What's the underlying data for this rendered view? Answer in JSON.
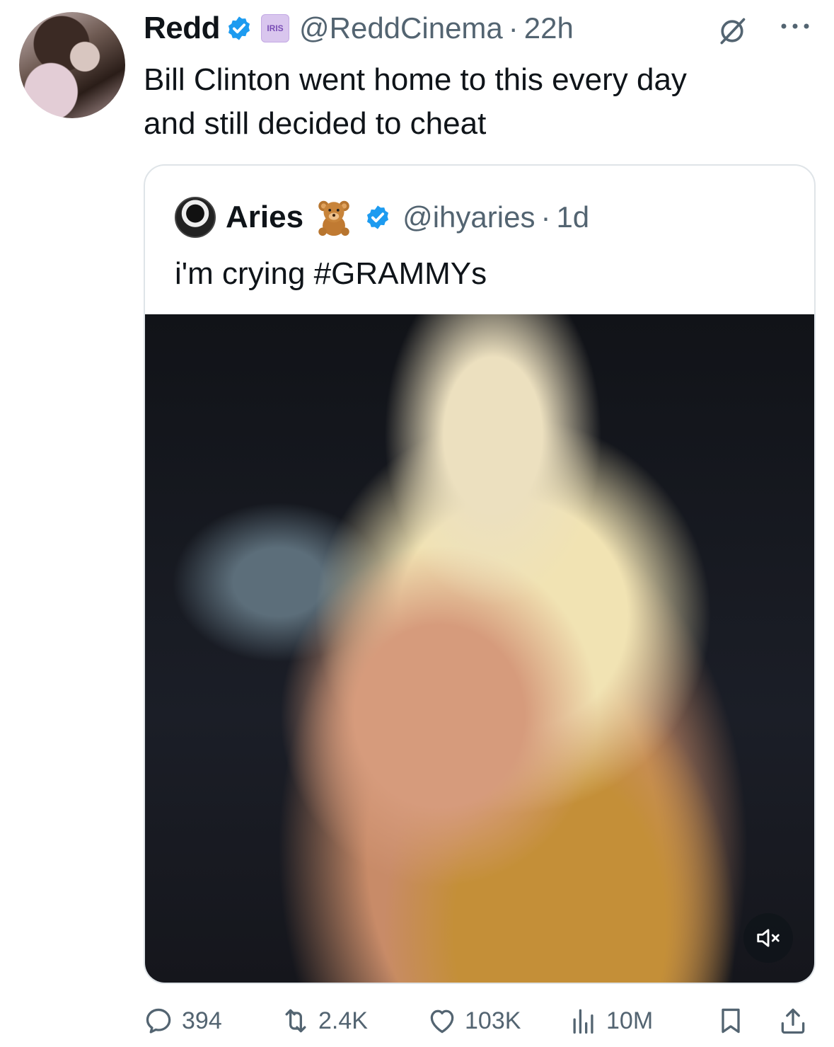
{
  "author": {
    "display_name": "Redd",
    "affiliate_badge": "IRIS",
    "handle": "@ReddCinema",
    "time": "22h"
  },
  "tweet": {
    "text_line1": "Bill Clinton went home to this every day",
    "text_line2": "and still decided to cheat"
  },
  "quoted": {
    "display_name": "Aries",
    "emoji": "teddy-bear",
    "handle": "@ihyaries",
    "time": "1d",
    "text": "i'm crying #GRAMMYs"
  },
  "metrics": {
    "replies": "394",
    "reposts": "2.4K",
    "likes": "103K",
    "views": "10M"
  },
  "colors": {
    "verified": "#1d9bf0",
    "secondary_text": "#536471",
    "primary_text": "#0f1419",
    "border": "#dfe4e8"
  },
  "icons": {
    "grok": "grok-icon",
    "more": "more-icon",
    "reply": "reply-icon",
    "repost": "repost-icon",
    "like": "heart-icon",
    "views": "views-icon",
    "bookmark": "bookmark-icon",
    "share": "share-icon",
    "mute": "mute-icon"
  }
}
